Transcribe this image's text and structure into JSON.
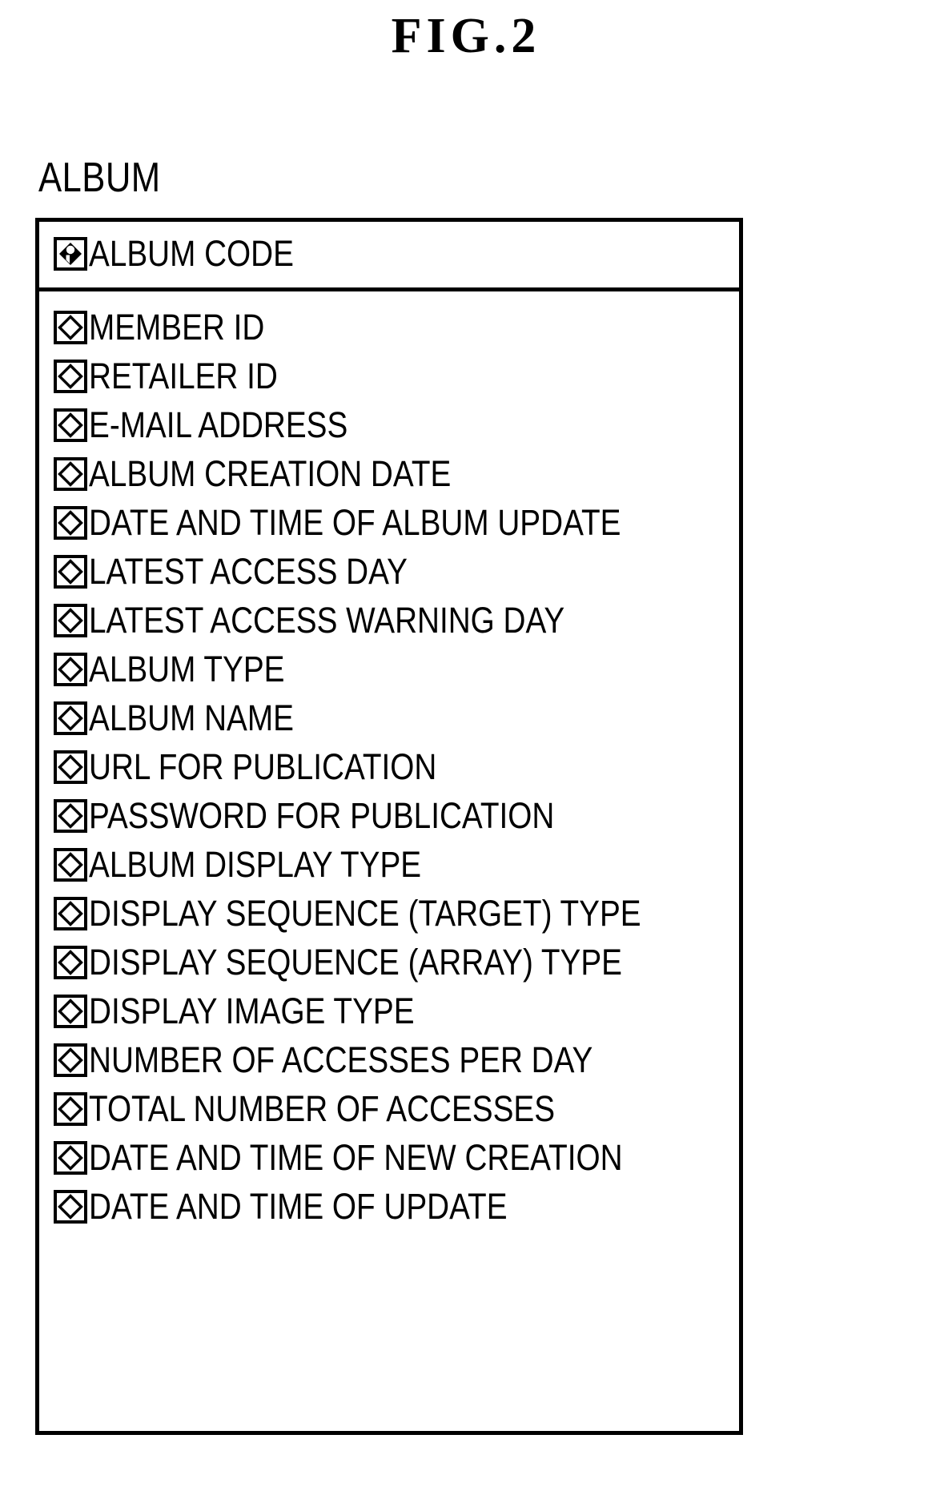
{
  "figure": {
    "title": "FIG.2",
    "entity_name": "ALBUM"
  },
  "entity": {
    "name": "ALBUM",
    "primary_key": {
      "icon": "primary-key-icon",
      "label": "ALBUM CODE"
    },
    "attributes": [
      {
        "icon": "attribute-diamond-icon",
        "label": "MEMBER ID"
      },
      {
        "icon": "attribute-diamond-icon",
        "label": "RETAILER ID"
      },
      {
        "icon": "attribute-diamond-icon",
        "label": "E-MAIL ADDRESS"
      },
      {
        "icon": "attribute-diamond-icon",
        "label": "ALBUM CREATION DATE"
      },
      {
        "icon": "attribute-diamond-icon",
        "label": "DATE AND TIME OF ALBUM UPDATE"
      },
      {
        "icon": "attribute-diamond-icon",
        "label": "LATEST ACCESS DAY"
      },
      {
        "icon": "attribute-diamond-icon",
        "label": "LATEST ACCESS WARNING DAY"
      },
      {
        "icon": "attribute-diamond-icon",
        "label": "ALBUM TYPE"
      },
      {
        "icon": "attribute-diamond-icon",
        "label": "ALBUM NAME"
      },
      {
        "icon": "attribute-diamond-icon",
        "label": "URL FOR PUBLICATION"
      },
      {
        "icon": "attribute-diamond-icon",
        "label": "PASSWORD FOR PUBLICATION"
      },
      {
        "icon": "attribute-diamond-icon",
        "label": "ALBUM DISPLAY TYPE"
      },
      {
        "icon": "attribute-diamond-icon",
        "label": "DISPLAY SEQUENCE (TARGET) TYPE"
      },
      {
        "icon": "attribute-diamond-icon",
        "label": "DISPLAY SEQUENCE (ARRAY) TYPE"
      },
      {
        "icon": "attribute-diamond-icon",
        "label": "DISPLAY IMAGE TYPE"
      },
      {
        "icon": "attribute-diamond-icon",
        "label": "NUMBER OF ACCESSES PER DAY"
      },
      {
        "icon": "attribute-diamond-icon",
        "label": "TOTAL NUMBER OF ACCESSES"
      },
      {
        "icon": "attribute-diamond-icon",
        "label": "DATE AND TIME OF NEW CREATION"
      },
      {
        "icon": "attribute-diamond-icon",
        "label": "DATE AND TIME OF UPDATE"
      }
    ]
  },
  "colors": {
    "ink": "#000000",
    "paper": "#ffffff"
  }
}
